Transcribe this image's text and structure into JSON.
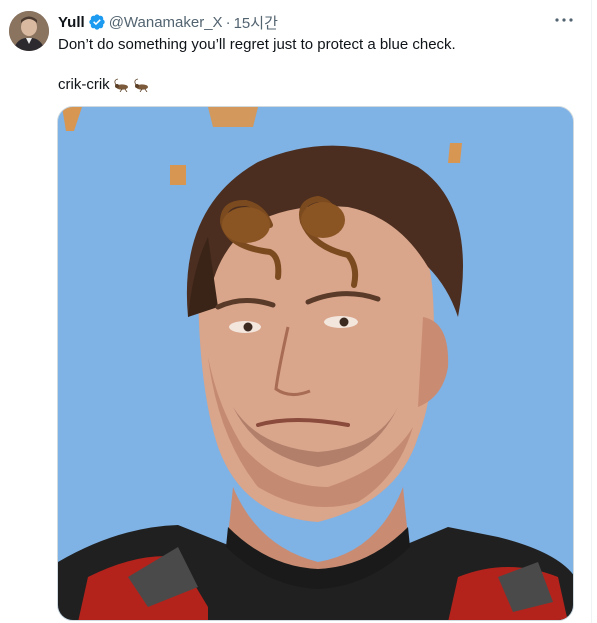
{
  "tweet": {
    "author": {
      "display_name": "Yull",
      "handle": "@Wanamaker_X",
      "separator": "·",
      "time": "15시간"
    },
    "text_line1": "Don’t do something you’ll regret just to protect a blue check.",
    "text_line2": "crik-crik",
    "icons": {
      "verified": "verified-badge-icon",
      "more": "more-options-icon",
      "emoji": "cricket-icon"
    },
    "colors": {
      "verified": "#1d9bf0",
      "secondary_text": "#536471",
      "media_background": "#7fb2e5"
    }
  }
}
